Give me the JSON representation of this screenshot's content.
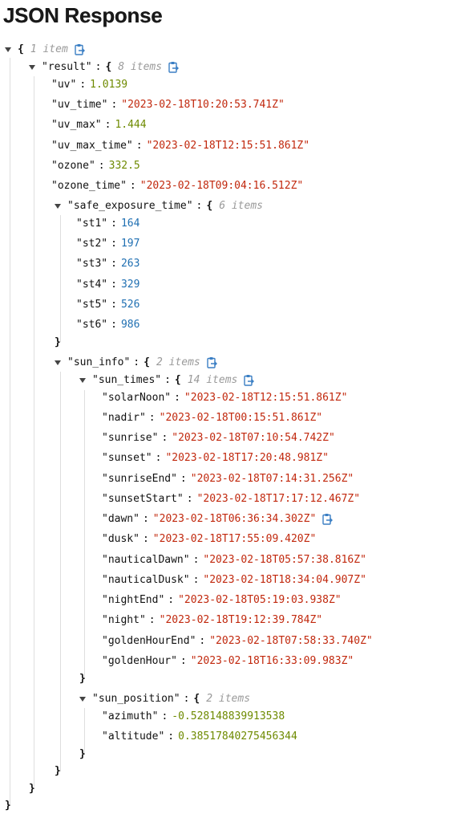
{
  "header": {
    "title": "JSON Response"
  },
  "root": {
    "open": "{",
    "close": "}",
    "meta": "1 item"
  },
  "result": {
    "key": "\"result\"",
    "open": "{",
    "close": "}",
    "meta": "8 items",
    "uv": {
      "key": "\"uv\"",
      "value": "1.0139"
    },
    "uv_time": {
      "key": "\"uv_time\"",
      "value": "\"2023-02-18T10:20:53.741Z\""
    },
    "uv_max": {
      "key": "\"uv_max\"",
      "value": "1.444"
    },
    "uv_max_time": {
      "key": "\"uv_max_time\"",
      "value": "\"2023-02-18T12:15:51.861Z\""
    },
    "ozone": {
      "key": "\"ozone\"",
      "value": "332.5"
    },
    "ozone_time": {
      "key": "\"ozone_time\"",
      "value": "\"2023-02-18T09:04:16.512Z\""
    },
    "safe_exposure_time": {
      "key": "\"safe_exposure_time\"",
      "open": "{",
      "close": "}",
      "meta": "6 items",
      "st1": {
        "key": "\"st1\"",
        "value": "164"
      },
      "st2": {
        "key": "\"st2\"",
        "value": "197"
      },
      "st3": {
        "key": "\"st3\"",
        "value": "263"
      },
      "st4": {
        "key": "\"st4\"",
        "value": "329"
      },
      "st5": {
        "key": "\"st5\"",
        "value": "526"
      },
      "st6": {
        "key": "\"st6\"",
        "value": "986"
      }
    },
    "sun_info": {
      "key": "\"sun_info\"",
      "open": "{",
      "close": "}",
      "meta": "2 items",
      "sun_times": {
        "key": "\"sun_times\"",
        "open": "{",
        "close": "}",
        "meta": "14 items",
        "solarNoon": {
          "key": "\"solarNoon\"",
          "value": "\"2023-02-18T12:15:51.861Z\""
        },
        "nadir": {
          "key": "\"nadir\"",
          "value": "\"2023-02-18T00:15:51.861Z\""
        },
        "sunrise": {
          "key": "\"sunrise\"",
          "value": "\"2023-02-18T07:10:54.742Z\""
        },
        "sunset": {
          "key": "\"sunset\"",
          "value": "\"2023-02-18T17:20:48.981Z\""
        },
        "sunriseEnd": {
          "key": "\"sunriseEnd\"",
          "value": "\"2023-02-18T07:14:31.256Z\""
        },
        "sunsetStart": {
          "key": "\"sunsetStart\"",
          "value": "\"2023-02-18T17:17:12.467Z\""
        },
        "dawn": {
          "key": "\"dawn\"",
          "value": "\"2023-02-18T06:36:34.302Z\""
        },
        "dusk": {
          "key": "\"dusk\"",
          "value": "\"2023-02-18T17:55:09.420Z\""
        },
        "nauticalDawn": {
          "key": "\"nauticalDawn\"",
          "value": "\"2023-02-18T05:57:38.816Z\""
        },
        "nauticalDusk": {
          "key": "\"nauticalDusk\"",
          "value": "\"2023-02-18T18:34:04.907Z\""
        },
        "nightEnd": {
          "key": "\"nightEnd\"",
          "value": "\"2023-02-18T05:19:03.938Z\""
        },
        "night": {
          "key": "\"night\"",
          "value": "\"2023-02-18T19:12:39.784Z\""
        },
        "goldenHourEnd": {
          "key": "\"goldenHourEnd\"",
          "value": "\"2023-02-18T07:58:33.740Z\""
        },
        "goldenHour": {
          "key": "\"goldenHour\"",
          "value": "\"2023-02-18T16:33:09.983Z\""
        }
      },
      "sun_position": {
        "key": "\"sun_position\"",
        "open": "{",
        "close": "}",
        "meta": "2 items",
        "azimuth": {
          "key": "\"azimuth\"",
          "value": "-0.528148839913538"
        },
        "altitude": {
          "key": "\"altitude\"",
          "value": "0.38517840275456344"
        }
      }
    }
  },
  "colors": {
    "string": "#c1280d",
    "decimal": "#6e8a00",
    "integer": "#1f6fb2",
    "meta": "#9a9a9a",
    "copy_icon": "#3b7fc4"
  },
  "icons": {
    "toggle": "caret-down-icon",
    "copy": "clipboard-copy-icon"
  }
}
